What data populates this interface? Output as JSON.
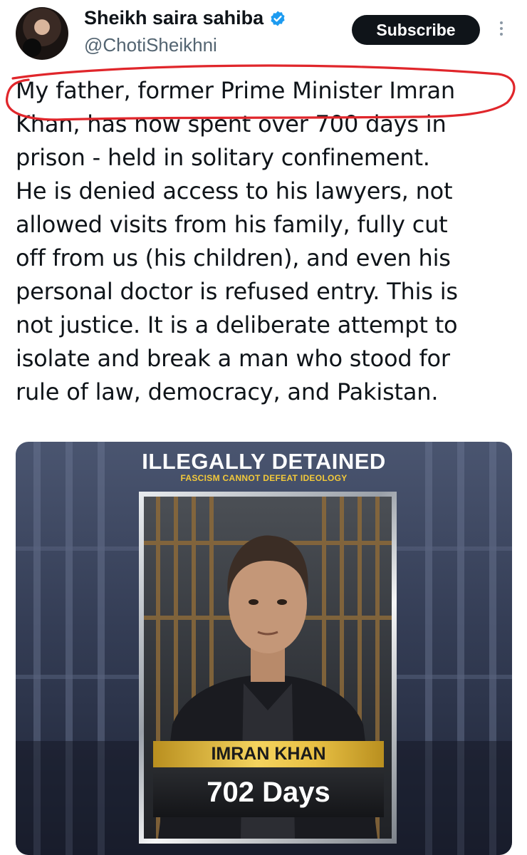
{
  "author": {
    "display_name": "Sheikh saira sahiba",
    "handle": "@ChotiSheikhni",
    "verified": true
  },
  "actions": {
    "subscribe_label": "Subscribe",
    "more_icon": "more-vertical-icon"
  },
  "tweet": {
    "text": "My father, former Prime Minister Imran\nKhan, has now spent over 700 days in\nprison - held in solitary confinement.\nHe is denied access to his lawyers, not\nallowed visits from his family, fully cut\noff from us (his children), and even his\npersonal doctor is refused entry. This is\nnot justice. It is a deliberate attempt to\nisolate and break a man who stood for\nrule of law, democracy, and Pakistan."
  },
  "media": {
    "title": "ILLEGALLY DETAINED",
    "subtitle": "FASCISM CANNOT DEFEAT IDEOLOGY",
    "name_plate": "IMRAN KHAN",
    "days": "702 Days"
  },
  "colors": {
    "annotation": "#e0262b",
    "verified": "#1d9bf0",
    "gold": "#f3c93a"
  }
}
